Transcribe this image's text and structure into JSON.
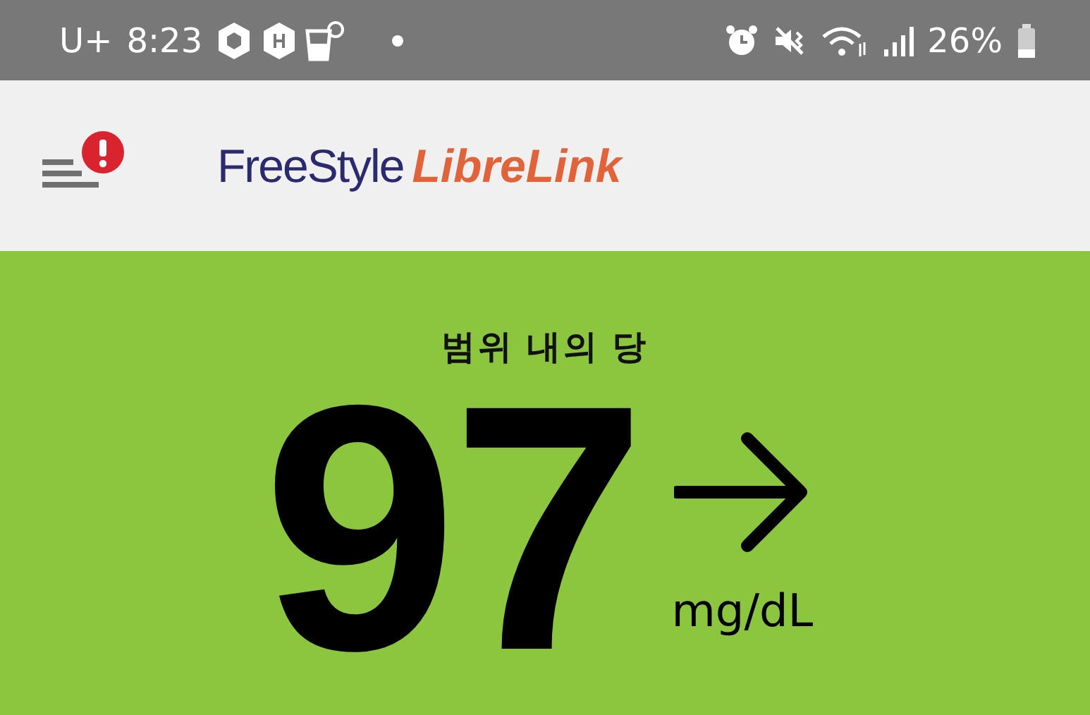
{
  "status_bar": {
    "carrier": "U+",
    "time": "8:23",
    "battery": "26%"
  },
  "header": {
    "alert": true,
    "logo_primary": "FreeStyle",
    "logo_secondary": "LibreLink"
  },
  "reading": {
    "label": "범위 내의 당",
    "value": "97",
    "unit": "mg/dL",
    "trend_arrow": {
      "kind": "steady"
    }
  }
}
